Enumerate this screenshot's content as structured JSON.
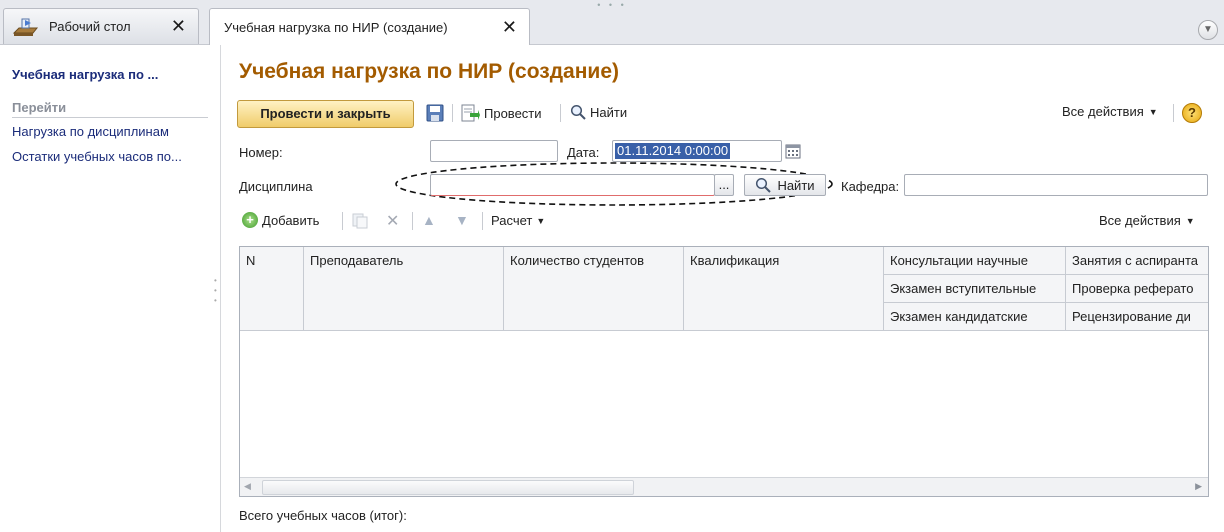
{
  "tabs": {
    "desktop_label": "Рабочий стол",
    "active_label": "Учебная нагрузка по НИР (создание)"
  },
  "left_panel": {
    "title": "Учебная нагрузка по ...",
    "section": "Перейти",
    "links": [
      "Нагрузка по дисциплинам",
      "Остатки учебных часов по..."
    ]
  },
  "form": {
    "title": "Учебная нагрузка по НИР (создание)",
    "toolbar": {
      "post_close": "Провести и закрыть",
      "post": "Провести",
      "find": "Найти",
      "all_actions": "Все действия"
    },
    "number_label": "Номер:",
    "date_label": "Дата:",
    "date_value": "01.11.2014  0:00:00",
    "discipline_label": "Дисциплина",
    "discipline_ellipsis": "...",
    "discipline_find": "Найти",
    "department_label": "Кафедра:"
  },
  "table": {
    "toolbar": {
      "add": "Добавить",
      "calc": "Расчет",
      "all_actions": "Все действия"
    },
    "columns": {
      "n": "N",
      "teacher": "Преподаватель",
      "students": "Количество студентов",
      "qualification": "Квалификация",
      "col5": [
        "Консультации научные",
        "Экзамен вступительные",
        "Экзамен кандидатские"
      ],
      "col6": [
        "Занятия с аспиранта",
        "Проверка реферато",
        "Рецензирование ди"
      ]
    },
    "rows": []
  },
  "footer": {
    "total_label": "Всего учебных часов (итог):"
  },
  "colors": {
    "title": "#a35b00",
    "link": "#1b2c7a",
    "selection": "#3960a8",
    "primary_button": "#f0cc6a"
  }
}
